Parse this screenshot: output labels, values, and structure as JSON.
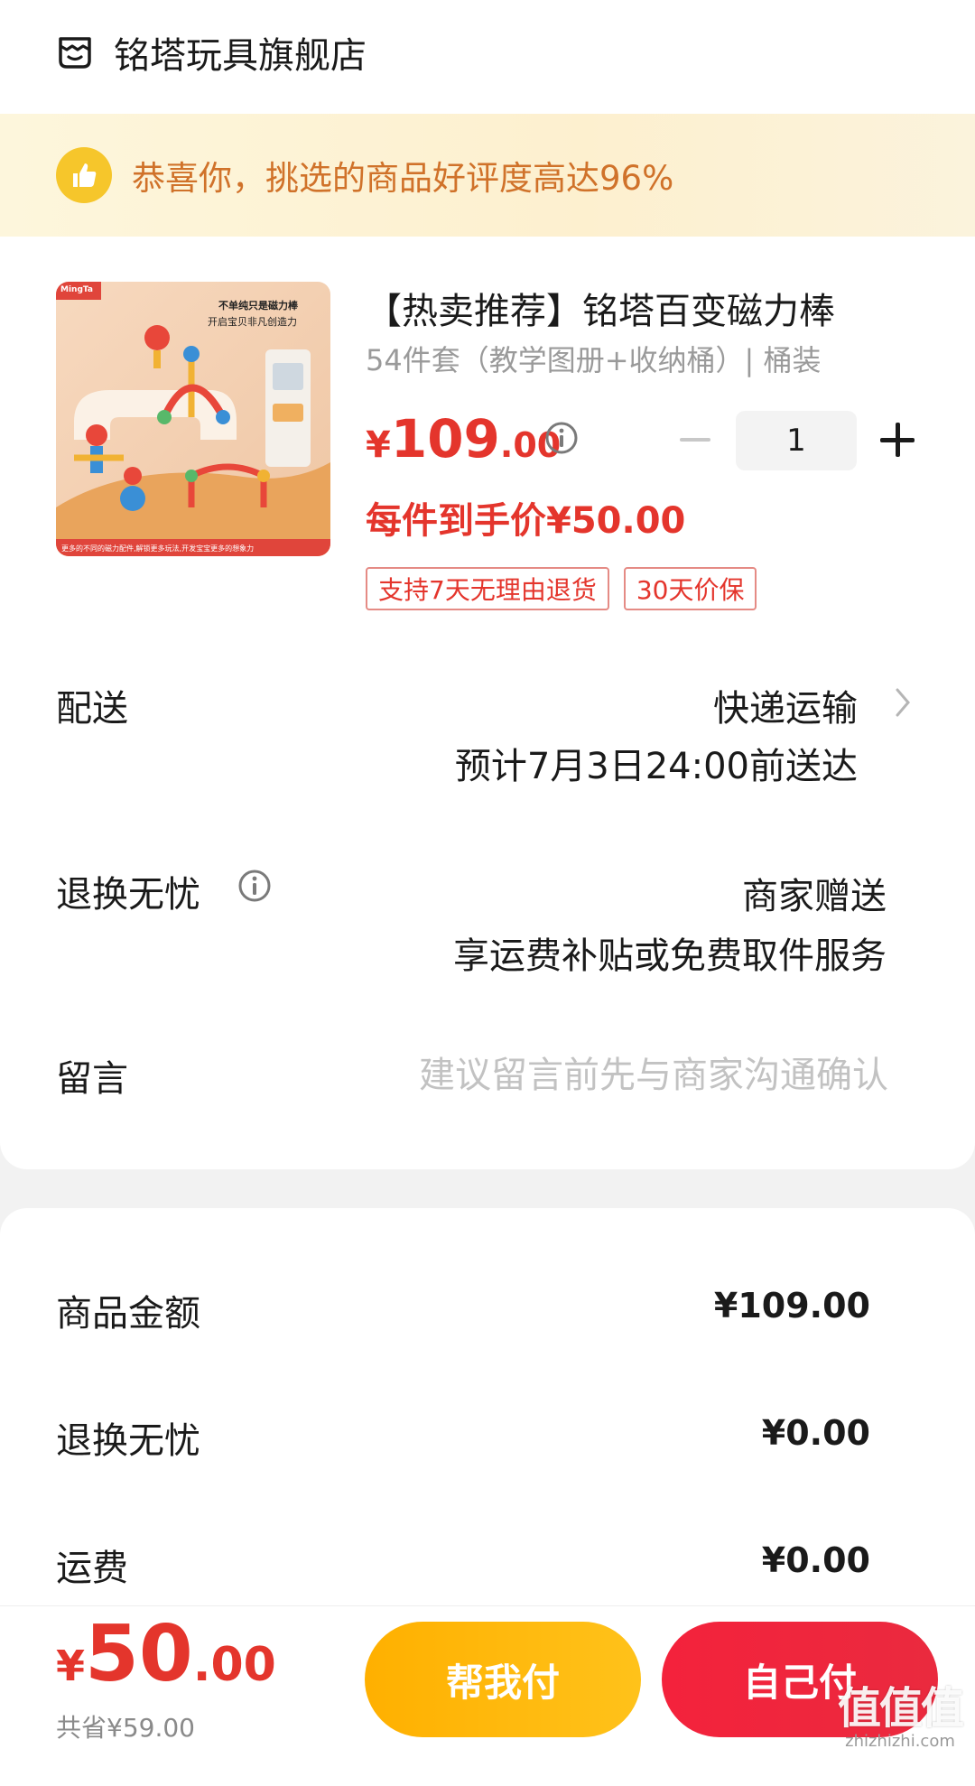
{
  "shop": {
    "icon": "store-icon",
    "name": "铭塔玩具旗舰店"
  },
  "banner": {
    "icon": "thumbs-up-icon",
    "text": "恭喜你，挑选的商品好评度高达96%"
  },
  "product": {
    "image_brand": "MingTa",
    "image_caption_1": "不单纯只是磁力棒",
    "image_caption_2": "开启宝贝非凡创造力",
    "image_caption_3": "更多的不同的磁力配件,解锁更多玩法,开发宝宝更多的想象力",
    "title": "【热卖推荐】铭塔百变磁力棒",
    "spec": "54件套（教学图册+收纳桶）| 桶装",
    "price_currency": "¥",
    "price_int": "109",
    "price_dec": ".00",
    "quantity": "1",
    "unit_price": "每件到手价¥50.00",
    "tags": [
      "支持7天无理由退货",
      "30天价保"
    ]
  },
  "delivery": {
    "label": "配送",
    "method": "快递运输",
    "eta": "预计7月3日24:00前送达"
  },
  "returns": {
    "label": "退换无忧",
    "value": "商家赠送",
    "desc": "享运费补贴或免费取件服务"
  },
  "note": {
    "label": "留言",
    "placeholder": "建议留言前先与商家沟通确认"
  },
  "summary": {
    "goods_label": "商品金额",
    "goods_value": "¥109.00",
    "returns_label": "退换无忧",
    "returns_value": "¥0.00",
    "shipping_label": "运费",
    "shipping_value": "¥0.00"
  },
  "footer": {
    "total_currency": "¥",
    "total_int": "50",
    "total_dec": ".00",
    "saved": "共省¥59.00",
    "help_pay_label": "帮我付",
    "self_pay_label": "自己付"
  },
  "watermark": {
    "main": "值值值",
    "sub": "zhizhizhi.com"
  },
  "colors": {
    "accent_red": "#e4352c",
    "banner_text": "#d0722a",
    "help_btn": "#ffb000",
    "self_btn": "#f4223c"
  }
}
